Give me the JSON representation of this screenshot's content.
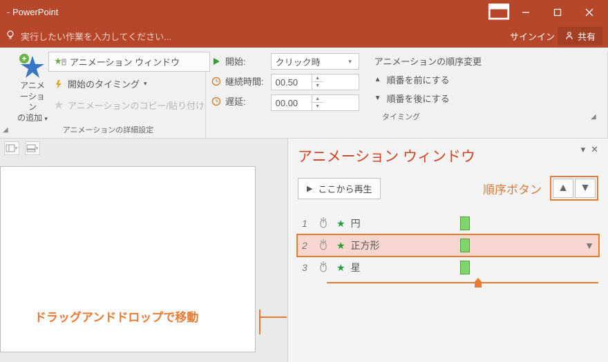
{
  "title": "- PowerPoint",
  "tellme": "実行したい作業を入力してください...",
  "signin": "サインイン",
  "share": "共有",
  "addAnimation": "アニメーション\nの追加",
  "advGroup": "アニメーションの詳細設定",
  "btnAnimPane": "アニメーション ウィンドウ",
  "btnTrigger": "開始のタイミング",
  "btnPainter": "アニメーションのコピー/貼り付け",
  "timing": {
    "startLabel": "開始:",
    "startValue": "クリック時",
    "durationLabel": "継続時間:",
    "durationValue": "00.50",
    "delayLabel": "遅延:",
    "delayValue": "00.00",
    "group": "タイミング"
  },
  "reorder": {
    "header": "アニメーションの順序変更",
    "earlier": "順番を前にする",
    "later": "順番を後にする"
  },
  "pane": {
    "title": "アニメーション ウィンドウ",
    "play": "ここから再生",
    "orderLabel": "順序ボタン"
  },
  "items": [
    {
      "num": "1",
      "name": "円"
    },
    {
      "num": "2",
      "name": "正方形"
    },
    {
      "num": "3",
      "name": "星"
    }
  ],
  "annotation": "ドラッグアンドドロップで移動"
}
